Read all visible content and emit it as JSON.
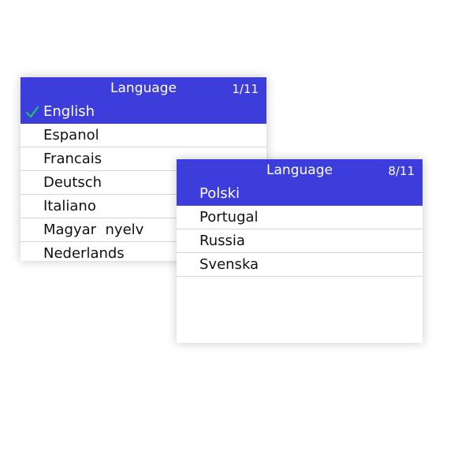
{
  "screens": [
    {
      "title": "Language",
      "page": "1/11",
      "items": [
        {
          "label": "English",
          "selected": true,
          "checked": true
        },
        {
          "label": "Espanol",
          "selected": false,
          "checked": false
        },
        {
          "label": "Francais",
          "selected": false,
          "checked": false
        },
        {
          "label": "Deutsch",
          "selected": false,
          "checked": false
        },
        {
          "label": "Italiano",
          "selected": false,
          "checked": false
        },
        {
          "label": "Magyar  nyelv",
          "selected": false,
          "checked": false
        },
        {
          "label": "Nederlands",
          "selected": false,
          "checked": false
        }
      ]
    },
    {
      "title": "Language",
      "page": "8/11",
      "items": [
        {
          "label": "Polski",
          "selected": true,
          "checked": false
        },
        {
          "label": "Portugal",
          "selected": false,
          "checked": false
        },
        {
          "label": "Russia",
          "selected": false,
          "checked": false
        },
        {
          "label": "Svenska",
          "selected": false,
          "checked": false
        }
      ]
    }
  ],
  "colors": {
    "title_bar": "#3d3ddc",
    "selected_row": "#3d3ddc",
    "check_icon": "#22c55e"
  },
  "icons": {
    "checked_item": "check-icon"
  }
}
